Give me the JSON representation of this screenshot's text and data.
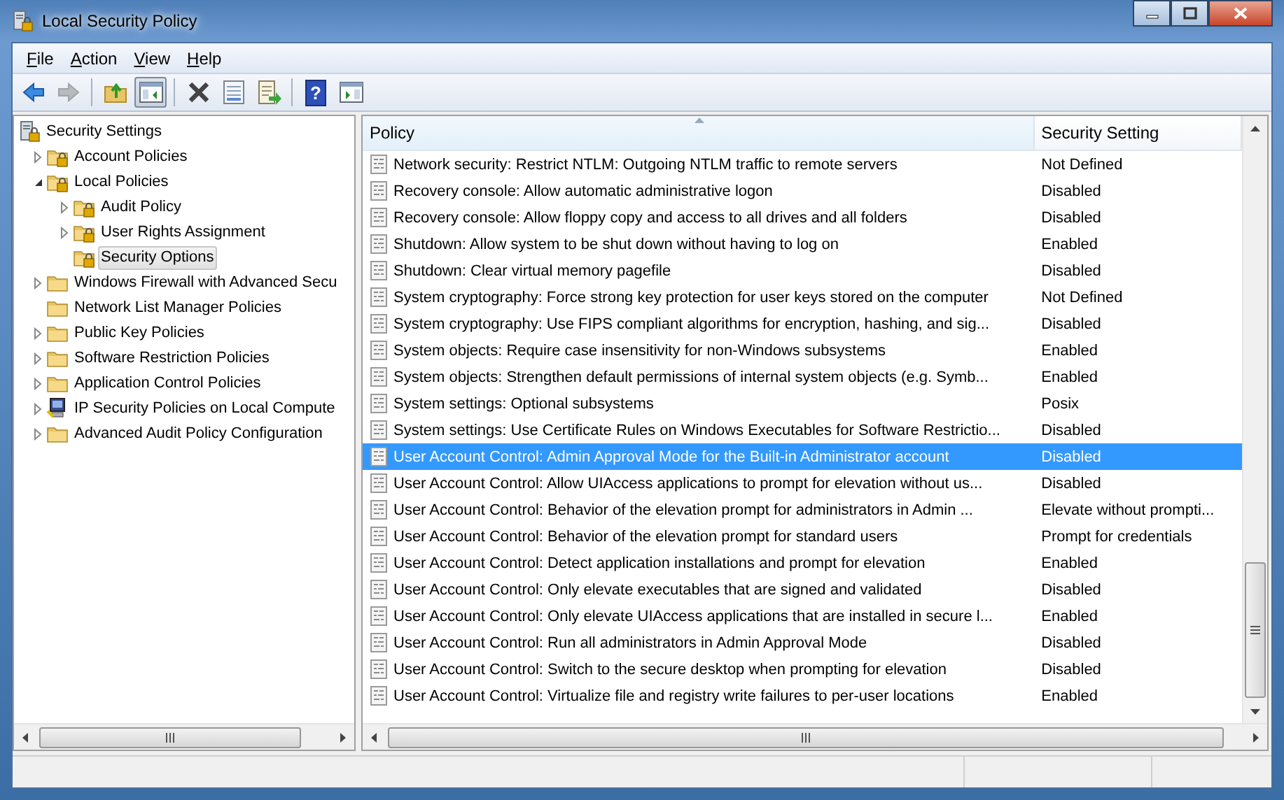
{
  "window": {
    "title": "Local Security Policy"
  },
  "menu": [
    "File",
    "Action",
    "View",
    "Help"
  ],
  "toolbar": [
    {
      "kind": "back",
      "disabled": false,
      "pressed": false
    },
    {
      "kind": "forward",
      "disabled": true,
      "pressed": false
    },
    {
      "kind": "sep"
    },
    {
      "kind": "up",
      "disabled": false,
      "pressed": false
    },
    {
      "kind": "tree",
      "disabled": false,
      "pressed": true
    },
    {
      "kind": "sep"
    },
    {
      "kind": "delete",
      "disabled": false,
      "pressed": false
    },
    {
      "kind": "properties",
      "disabled": false,
      "pressed": false
    },
    {
      "kind": "export",
      "disabled": false,
      "pressed": false
    },
    {
      "kind": "sep"
    },
    {
      "kind": "help",
      "label": "?",
      "disabled": false,
      "pressed": false
    },
    {
      "kind": "pane",
      "disabled": false,
      "pressed": false
    }
  ],
  "tree": [
    {
      "label": "Security Settings",
      "kind": "server",
      "selected": false,
      "children": [
        {
          "label": "Account Policies",
          "kind": "lock-folder",
          "expanded": false,
          "selected": false
        },
        {
          "label": "Local Policies",
          "kind": "lock-folder",
          "expanded": true,
          "selected": false,
          "children": [
            {
              "label": "Audit Policy",
              "kind": "lock-folder",
              "expanded": false,
              "selected": false
            },
            {
              "label": "User Rights Assignment",
              "kind": "lock-folder",
              "expanded": false,
              "selected": false
            },
            {
              "label": "Security Options",
              "kind": "lock-folder",
              "selected": true
            }
          ]
        },
        {
          "label": "Windows Firewall with Advanced Secu",
          "kind": "folder",
          "expanded": false,
          "selected": false
        },
        {
          "label": "Network List Manager Policies",
          "kind": "folder",
          "selected": false
        },
        {
          "label": "Public Key Policies",
          "kind": "folder",
          "expanded": false,
          "selected": false
        },
        {
          "label": "Software Restriction Policies",
          "kind": "folder",
          "expanded": false,
          "selected": false
        },
        {
          "label": "Application Control Policies",
          "kind": "folder",
          "expanded": false,
          "selected": false
        },
        {
          "label": "IP Security Policies on Local Compute",
          "kind": "computer",
          "expanded": false,
          "selected": false
        },
        {
          "label": "Advanced Audit Policy Configuration",
          "kind": "folder",
          "expanded": false,
          "selected": false
        }
      ]
    }
  ],
  "table": {
    "columns": [
      "Policy",
      "Security Setting"
    ],
    "rows": [
      {
        "policy": "Network security: Restrict NTLM: Outgoing NTLM traffic to remote servers",
        "setting": "Not Defined",
        "selected": false
      },
      {
        "policy": "Recovery console: Allow automatic administrative logon",
        "setting": "Disabled",
        "selected": false
      },
      {
        "policy": "Recovery console: Allow floppy copy and access to all drives and all folders",
        "setting": "Disabled",
        "selected": false
      },
      {
        "policy": "Shutdown: Allow system to be shut down without having to log on",
        "setting": "Enabled",
        "selected": false
      },
      {
        "policy": "Shutdown: Clear virtual memory pagefile",
        "setting": "Disabled",
        "selected": false
      },
      {
        "policy": "System cryptography: Force strong key protection for user keys stored on the computer",
        "setting": "Not Defined",
        "selected": false
      },
      {
        "policy": "System cryptography: Use FIPS compliant algorithms for encryption, hashing, and sig...",
        "setting": "Disabled",
        "selected": false
      },
      {
        "policy": "System objects: Require case insensitivity for non-Windows subsystems",
        "setting": "Enabled",
        "selected": false
      },
      {
        "policy": "System objects: Strengthen default permissions of internal system objects (e.g. Symb...",
        "setting": "Enabled",
        "selected": false
      },
      {
        "policy": "System settings: Optional subsystems",
        "setting": "Posix",
        "selected": false
      },
      {
        "policy": "System settings: Use Certificate Rules on Windows Executables for Software Restrictio...",
        "setting": "Disabled",
        "selected": false
      },
      {
        "policy": "User Account Control: Admin Approval Mode for the Built-in Administrator account",
        "setting": "Disabled",
        "selected": true
      },
      {
        "policy": "User Account Control: Allow UIAccess applications to prompt for elevation without us...",
        "setting": "Disabled",
        "selected": false
      },
      {
        "policy": "User Account Control: Behavior of the elevation prompt for administrators in Admin ...",
        "setting": "Elevate without prompti...",
        "selected": false
      },
      {
        "policy": "User Account Control: Behavior of the elevation prompt for standard users",
        "setting": "Prompt for credentials",
        "selected": false
      },
      {
        "policy": "User Account Control: Detect application installations and prompt for elevation",
        "setting": "Enabled",
        "selected": false
      },
      {
        "policy": "User Account Control: Only elevate executables that are signed and validated",
        "setting": "Disabled",
        "selected": false
      },
      {
        "policy": "User Account Control: Only elevate UIAccess applications that are installed in secure l...",
        "setting": "Enabled",
        "selected": false
      },
      {
        "policy": "User Account Control: Run all administrators in Admin Approval Mode",
        "setting": "Disabled",
        "selected": false
      },
      {
        "policy": "User Account Control: Switch to the secure desktop when prompting for elevation",
        "setting": "Disabled",
        "selected": false
      },
      {
        "policy": "User Account Control: Virtualize file and registry write failures to per-user locations",
        "setting": "Enabled",
        "selected": false
      }
    ]
  }
}
